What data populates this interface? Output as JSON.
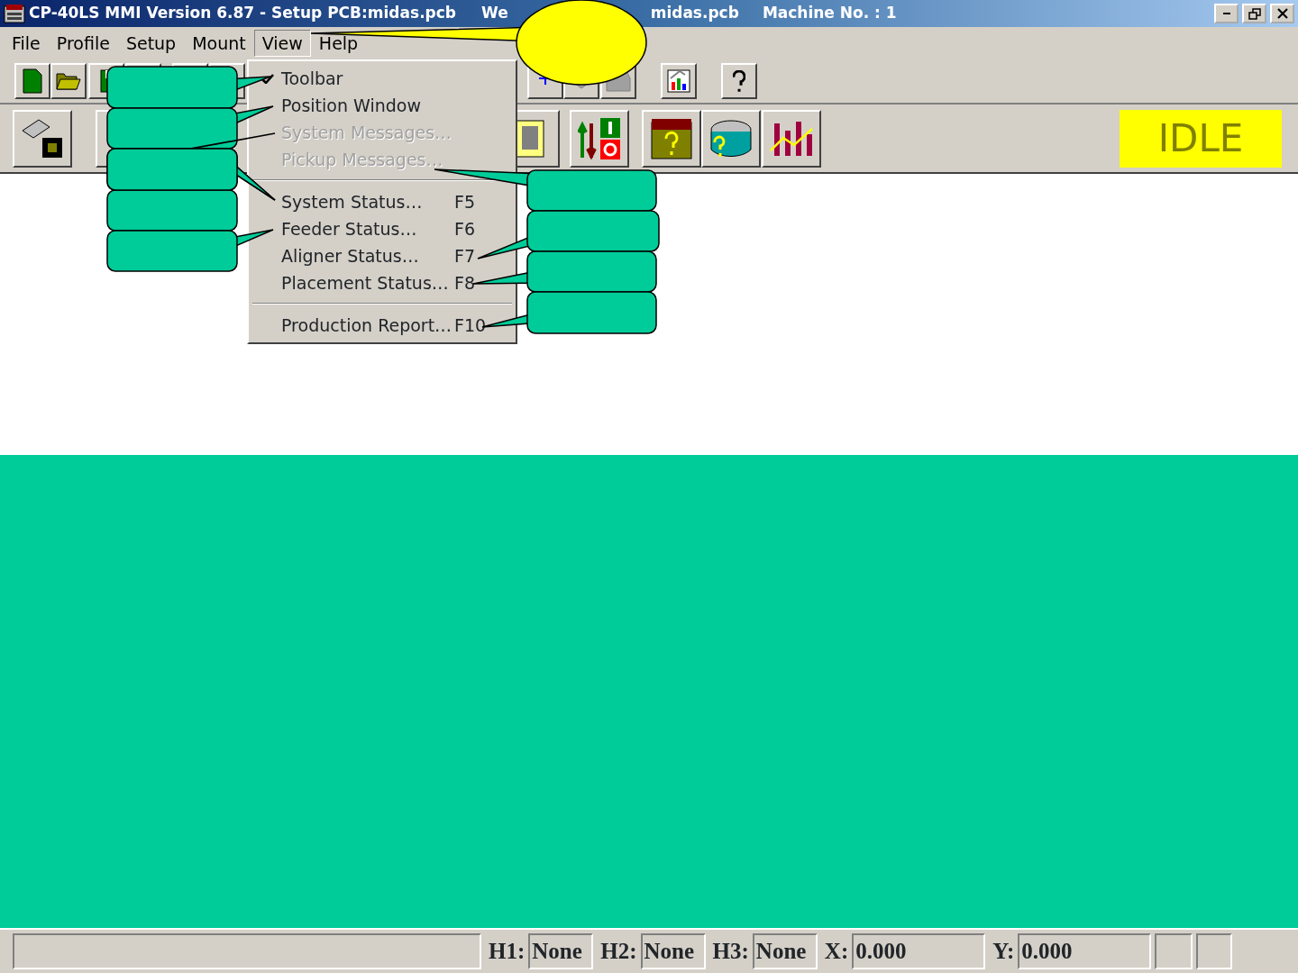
{
  "window": {
    "title_parts": [
      "CP-40LS MMI Version 6.87 - Setup PCB:midas.pcb",
      "We",
      "midas.pcb",
      "Machine No. : 1"
    ]
  },
  "menubar": [
    {
      "label": "File",
      "selected": false
    },
    {
      "label": "Profile",
      "selected": false
    },
    {
      "label": "Setup",
      "selected": false
    },
    {
      "label": "Mount",
      "selected": false
    },
    {
      "label": "View",
      "selected": true
    },
    {
      "label": "Help",
      "selected": false
    }
  ],
  "view_menu": [
    {
      "kind": "item",
      "label": "Toolbar",
      "checked": true,
      "disabled": false
    },
    {
      "kind": "item",
      "label": "Position Window",
      "checked": false,
      "disabled": false
    },
    {
      "kind": "item",
      "label": "System Messages…",
      "checked": false,
      "disabled": true
    },
    {
      "kind": "item",
      "label": "Pickup Messages…",
      "checked": false,
      "disabled": true
    },
    {
      "kind": "separator"
    },
    {
      "kind": "item",
      "label": "System Status…",
      "shortcut": "F5",
      "checked": false,
      "disabled": false
    },
    {
      "kind": "item",
      "label": "Feeder Status…",
      "shortcut": "F6",
      "checked": false,
      "disabled": false
    },
    {
      "kind": "item",
      "label": "Aligner Status…",
      "shortcut": "F7",
      "checked": false,
      "disabled": false
    },
    {
      "kind": "item",
      "label": "Placement Status…",
      "shortcut": "F8",
      "checked": false,
      "disabled": false
    },
    {
      "kind": "separator"
    },
    {
      "kind": "item",
      "label": "Production Report…",
      "shortcut": "F10",
      "checked": false,
      "disabled": false
    }
  ],
  "machine_state": "IDLE",
  "status_bar": [
    {
      "label": "H1:",
      "value": "None"
    },
    {
      "label": "H2:",
      "value": "None"
    },
    {
      "label": "H3:",
      "value": "None"
    },
    {
      "label": "X:",
      "value": "0.000"
    },
    {
      "label": "Y:",
      "value": "0.000"
    }
  ]
}
